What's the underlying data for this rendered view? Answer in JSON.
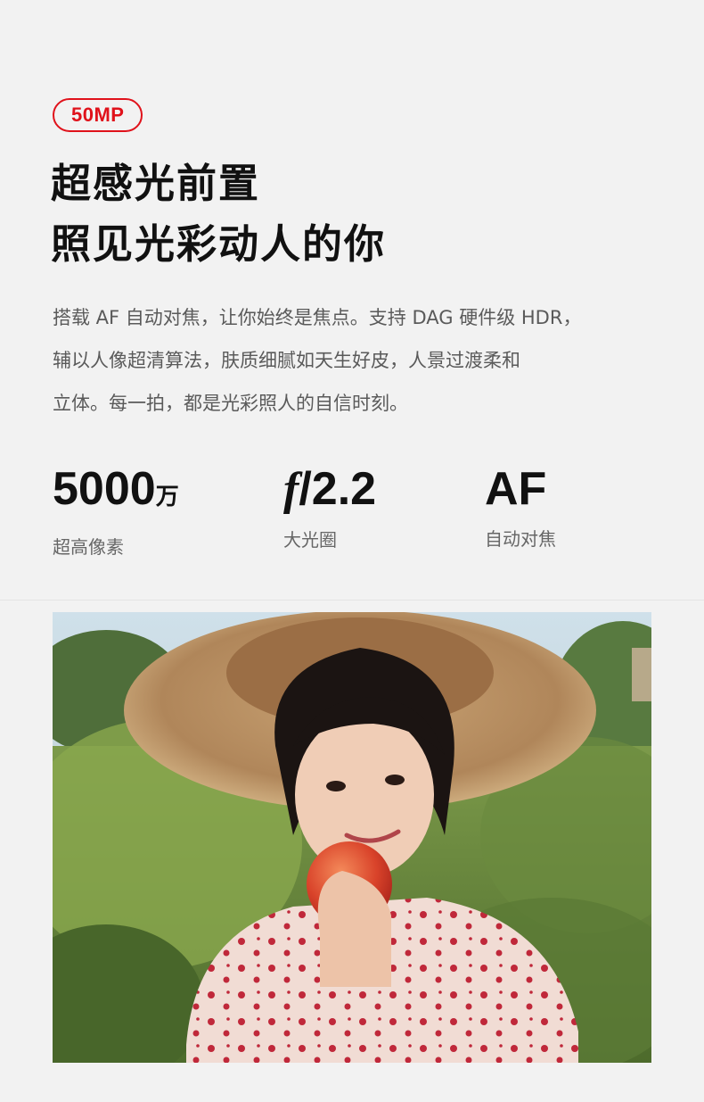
{
  "badge": "50MP",
  "headline": {
    "line1": "超感光前置",
    "line2": "照见光彩动人的你"
  },
  "description": {
    "line1": "搭载 AF 自动对焦，让你始终是焦点。支持 DAG 硬件级 HDR，",
    "line2": "辅以人像超清算法，肤质细腻如天生好皮，人景过渡柔和",
    "line3": "立体。每一拍，都是光彩照人的自信时刻。"
  },
  "specs": [
    {
      "value": "5000",
      "unit": "万",
      "label": "超高像素"
    },
    {
      "symbol": "f",
      "value": "/2.2",
      "label": "大光圈"
    },
    {
      "value": "AF",
      "label": "自动对焦"
    }
  ],
  "colors": {
    "accent": "#e0121b",
    "background": "#f2f2f2",
    "text": "#111111",
    "muted": "#5a5a5a"
  }
}
